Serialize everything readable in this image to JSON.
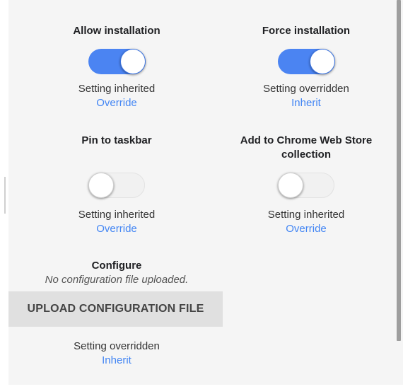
{
  "settings": [
    {
      "title": "Allow installation",
      "toggle_on": true,
      "status": "Setting inherited",
      "action": "Override"
    },
    {
      "title": "Force installation",
      "toggle_on": true,
      "status": "Setting overridden",
      "action": "Inherit"
    },
    {
      "title": "Pin to taskbar",
      "toggle_on": false,
      "status": "Setting inherited",
      "action": "Override"
    },
    {
      "title_line1": "Add to Chrome Web Store",
      "title_line2": "collection",
      "toggle_on": false,
      "status": "Setting inherited",
      "action": "Override"
    }
  ],
  "configure": {
    "title": "Configure",
    "note": "No configuration file uploaded.",
    "upload_label": "UPLOAD CONFIGURATION FILE",
    "status": "Setting overridden",
    "action": "Inherit"
  },
  "colors": {
    "toggle_on": "#4b84f2",
    "link": "#4285f4",
    "panel_background": "#f5f5f5",
    "button_background": "#e0e0e0"
  }
}
